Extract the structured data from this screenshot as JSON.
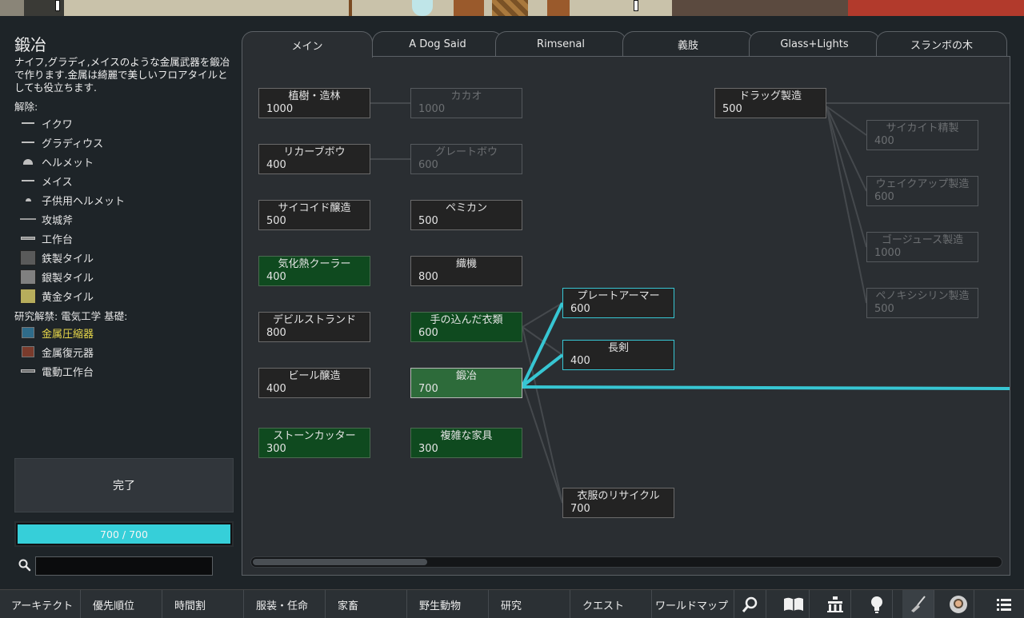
{
  "project": {
    "title": "鍛冶",
    "description": "ナイフ,グラディ,メイスのような金属武器を鍛冶で作ります.金属は綺麗で美しいフロアタイルとしても役立ちます.",
    "unlocks_label": "解除:",
    "unlocks": [
      {
        "label": "イクワ",
        "icon": "spear-icon"
      },
      {
        "label": "グラディウス",
        "icon": "sword-icon"
      },
      {
        "label": "ヘルメット",
        "icon": "helmet-icon"
      },
      {
        "label": "メイス",
        "icon": "mace-icon"
      },
      {
        "label": "子供用ヘルメット",
        "icon": "child-helmet-icon"
      },
      {
        "label": "攻城斧",
        "icon": "axe-icon"
      },
      {
        "label": "工作台",
        "icon": "workbench-icon"
      },
      {
        "label": "鉄製タイル",
        "icon": "tile-icon",
        "color": "#5a5a5a"
      },
      {
        "label": "銀製タイル",
        "icon": "tile-icon",
        "color": "#808080"
      },
      {
        "label": "黄金タイル",
        "icon": "tile-icon",
        "color": "#b7ad5c"
      }
    ],
    "prereq_label": "研究解禁: 電気工学 基礎:",
    "prereq_unlocks": [
      {
        "label": "金属圧縮器",
        "icon": "compressor-icon",
        "highlight": true
      },
      {
        "label": "金属復元器",
        "icon": "restorer-icon",
        "highlight": false
      },
      {
        "label": "電動工作台",
        "icon": "electric-bench-icon",
        "highlight": false
      }
    ],
    "done_label": "完了",
    "progress_text": "700 / 700",
    "progress_fraction": 1.0,
    "accent_color": "#36cfd9"
  },
  "search": {
    "placeholder": "",
    "value": ""
  },
  "tabs": [
    {
      "label": "メイン",
      "active": true
    },
    {
      "label": "A Dog Said",
      "active": false
    },
    {
      "label": "Rimsenal",
      "active": false
    },
    {
      "label": "義肢",
      "active": false
    },
    {
      "label": "Glass+Lights",
      "active": false
    },
    {
      "label": "スランボの木",
      "active": false
    }
  ],
  "nodes": [
    {
      "id": "tree_planting",
      "name": "植樹・造林",
      "cost": "1000",
      "state": "normal"
    },
    {
      "id": "recurve_bow",
      "name": "リカーブボウ",
      "cost": "400",
      "state": "normal"
    },
    {
      "id": "psychoid",
      "name": "サイコイド醸造",
      "cost": "500",
      "state": "normal"
    },
    {
      "id": "cooler",
      "name": "気化熱クーラー",
      "cost": "400",
      "state": "done"
    },
    {
      "id": "devilstrand",
      "name": "デビルストランド",
      "cost": "800",
      "state": "normal"
    },
    {
      "id": "beer",
      "name": "ビール醸造",
      "cost": "400",
      "state": "normal"
    },
    {
      "id": "stonecutter",
      "name": "ストーンカッター",
      "cost": "300",
      "state": "done"
    },
    {
      "id": "cocoa",
      "name": "カカオ",
      "cost": "1000",
      "state": "dim"
    },
    {
      "id": "great_bow",
      "name": "グレートボウ",
      "cost": "600",
      "state": "dim"
    },
    {
      "id": "pemmican",
      "name": "ペミカン",
      "cost": "500",
      "state": "normal"
    },
    {
      "id": "loom",
      "name": "織機",
      "cost": "800",
      "state": "normal"
    },
    {
      "id": "complex_clothing",
      "name": "手の込んだ衣類",
      "cost": "600",
      "state": "done"
    },
    {
      "id": "smithing",
      "name": "鍛冶",
      "cost": "700",
      "state": "selected"
    },
    {
      "id": "complex_furniture",
      "name": "複雑な家具",
      "cost": "300",
      "state": "done"
    },
    {
      "id": "plate_armor",
      "name": "プレートアーマー",
      "cost": "600",
      "state": "highlight"
    },
    {
      "id": "longsword",
      "name": "長剣",
      "cost": "400",
      "state": "highlight"
    },
    {
      "id": "recycle",
      "name": "衣服のリサイクル",
      "cost": "700",
      "state": "normal"
    },
    {
      "id": "drug_production",
      "name": "ドラッグ製造",
      "cost": "500",
      "state": "normal"
    },
    {
      "id": "psychite",
      "name": "サイカイト精製",
      "cost": "400",
      "state": "dim"
    },
    {
      "id": "wakeup",
      "name": "ウェイクアップ製造",
      "cost": "600",
      "state": "dim"
    },
    {
      "id": "gojuice",
      "name": "ゴージュース製造",
      "cost": "1000",
      "state": "dim"
    },
    {
      "id": "penoxycyline",
      "name": "ペノキシシリン製造",
      "cost": "500",
      "state": "dim"
    }
  ],
  "bottom_bar": [
    {
      "label": "アーキテクト"
    },
    {
      "label": "優先順位"
    },
    {
      "label": "時間割"
    },
    {
      "label": "服装・任命"
    },
    {
      "label": "家畜"
    },
    {
      "label": "野生動物"
    },
    {
      "label": "研究"
    },
    {
      "label": "クエスト"
    },
    {
      "label": "ワールドマップ"
    }
  ],
  "bottom_icons": [
    {
      "name": "search-icon"
    },
    {
      "name": "book-icon"
    },
    {
      "name": "faction-icon"
    },
    {
      "name": "lightbulb-icon"
    },
    {
      "name": "broom-icon"
    },
    {
      "name": "astronaut-icon"
    },
    {
      "name": "menu-icon"
    }
  ]
}
